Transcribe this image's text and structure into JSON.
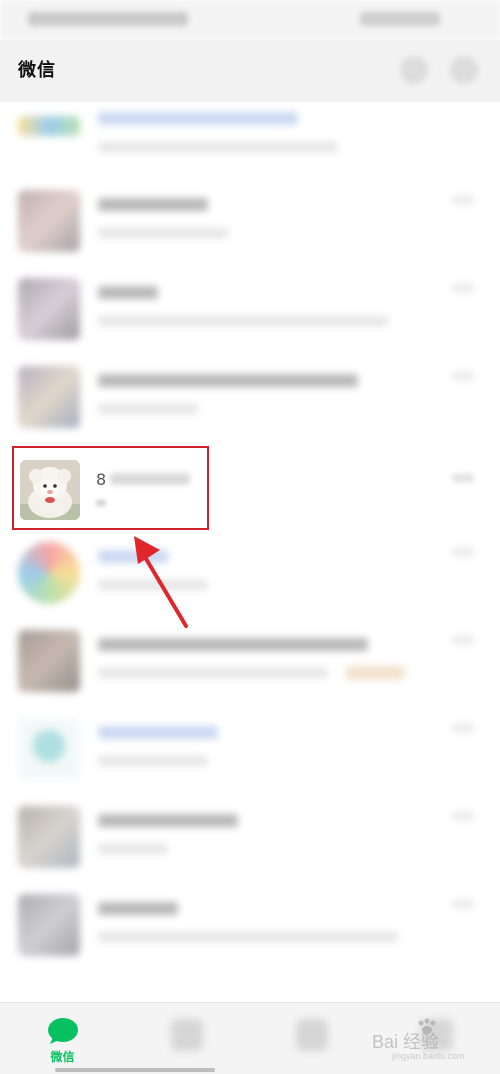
{
  "header": {
    "title": "微信"
  },
  "highlighted_chat": {
    "name_visible_char": "8"
  },
  "tabbar": {
    "chats_label": "微信"
  },
  "watermark": {
    "text": "Bai 经验",
    "sub": "jingyan.baidu.com"
  },
  "colors": {
    "accent_green": "#07c160",
    "highlight_red": "#d3212b",
    "arrow_red": "#e0262b"
  },
  "icons": [
    "search-icon",
    "plus-icon",
    "chat-bubble-icon",
    "contacts-icon",
    "discover-icon",
    "me-icon",
    "paw-logo-icon"
  ]
}
